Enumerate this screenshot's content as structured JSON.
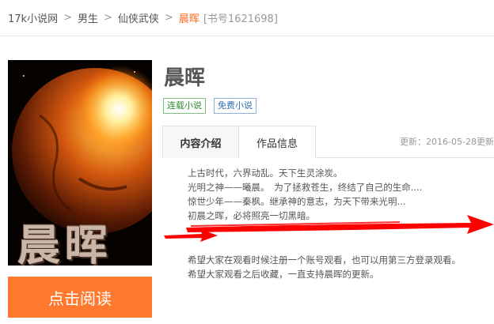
{
  "breadcrumb": {
    "items": [
      "17k小说网",
      "男生",
      "仙侠武侠"
    ],
    "separator": ">",
    "current": "晨晖",
    "book_id": "[书号1621698]"
  },
  "book": {
    "title": "晨晖",
    "cover_title": "晨晖",
    "tags": [
      "连载小说",
      "免费小说"
    ]
  },
  "tabs": [
    {
      "label": "内容介绍",
      "active": true
    },
    {
      "label": "作品信息",
      "active": false
    }
  ],
  "update_time": "更新：2016-05-28更新",
  "description": {
    "lines_top": [
      "上古时代，六界动乱。天下生灵涂炭。",
      "光明之神——曦晨。　为了拯救苍生，终结了自己的生命....",
      "惊世少年——秦枫。继承神的意志，为天下带来光明...",
      "初晨之晖，必将照亮一切黑暗。"
    ],
    "lines_bottom": [
      "希望大家在观看时候注册一个账号观看，也可以用第三方登录观看。",
      "希望大家观看之后收藏，一直支持晨晖的更新。"
    ]
  },
  "read_button": {
    "label": "点击阅读"
  },
  "colors": {
    "accent": "#ff6a1f",
    "button": "#ff7a2f",
    "arrow": "#ff0000"
  }
}
